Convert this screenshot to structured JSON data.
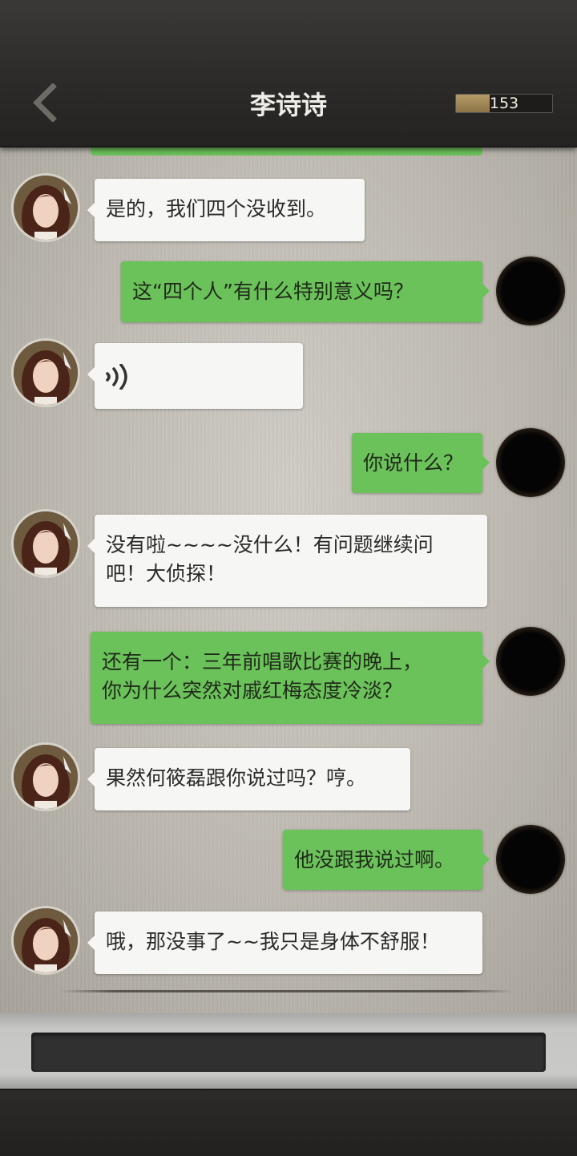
{
  "header": {
    "title": "李诗诗",
    "counter_value": "153",
    "counter_fill_fraction": 0.35
  },
  "messages": [
    {
      "side": "left",
      "type": "text",
      "text": "是的，我们四个没收到。"
    },
    {
      "side": "right",
      "type": "text",
      "text": "这“四个人”有什么特别意义吗？"
    },
    {
      "side": "left",
      "type": "voice",
      "icon": "voice-icon"
    },
    {
      "side": "right",
      "type": "text",
      "text": "你说什么？"
    },
    {
      "side": "left",
      "type": "text",
      "line1": "没有啦~~~~没什么！有问题继续问",
      "line2": "吧！大侦探！"
    },
    {
      "side": "right",
      "type": "text",
      "line1": "还有一个：三年前唱歌比赛的晚上，",
      "line2": "你为什么突然对戚红梅态度冷淡？"
    },
    {
      "side": "left",
      "type": "text",
      "text": "果然何筱磊跟你说过吗？哼。"
    },
    {
      "side": "right",
      "type": "text",
      "text": "他没跟我说过啊。"
    },
    {
      "side": "left",
      "type": "text",
      "text": "哦，那没事了~~我只是身体不舒服！"
    }
  ],
  "input": {
    "value": ""
  },
  "colors": {
    "accent_green": "#6cc25a",
    "bubble_left": "#f6f6f4",
    "header_bg": "#2b2a28"
  }
}
